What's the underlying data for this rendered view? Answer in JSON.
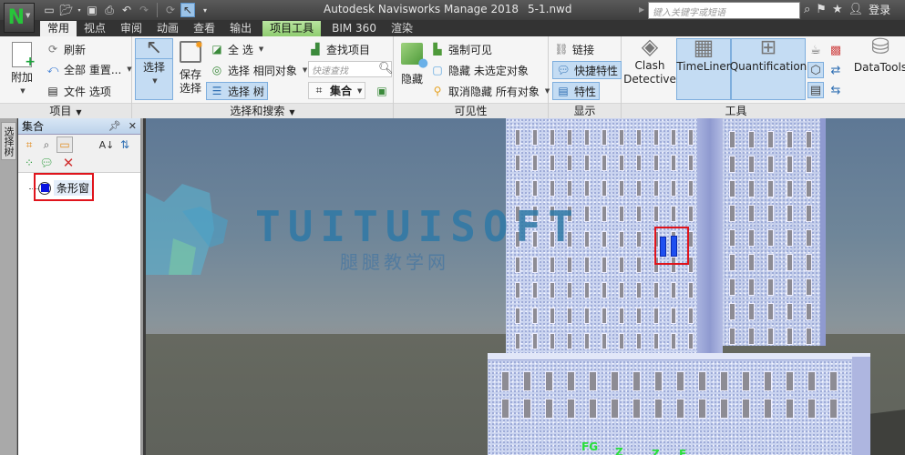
{
  "app": {
    "title": "Autodesk Navisworks Manage 2018",
    "filename": "5-1.nwd",
    "logo_letter": "N"
  },
  "quick_access": {
    "icons": [
      "new-file-icon",
      "open-folder-icon",
      "save-icon",
      "print-icon",
      "undo-icon",
      "redo-icon",
      "refresh-icon",
      "select-cursor-icon",
      "customize-dropdown-icon"
    ]
  },
  "search": {
    "placeholder": "键入关键字或短语"
  },
  "top_right": {
    "login_label": "登录"
  },
  "tabs": [
    {
      "label": "常用",
      "active": true
    },
    {
      "label": "视点"
    },
    {
      "label": "审阅"
    },
    {
      "label": "动画"
    },
    {
      "label": "查看"
    },
    {
      "label": "输出"
    },
    {
      "label": "项目工具",
      "contextual": true
    },
    {
      "label": "BIM 360"
    },
    {
      "label": "渲染"
    }
  ],
  "ribbon": {
    "project": {
      "label": "项目",
      "append": "附加",
      "refresh": "刷新",
      "reset_all": "全部 重置...",
      "file_options": "文件 选项"
    },
    "select_search": {
      "label": "选择和搜索",
      "select": "选择",
      "save_selection_1": "保存",
      "save_selection_2": "选择",
      "select_all": "全 选",
      "select_same": "选择 相同对象",
      "selection_tree": "选择 树",
      "find_items": "查找项目",
      "quick_find_placeholder": "快速查找",
      "sets": "集合"
    },
    "visibility": {
      "label": "可见性",
      "hide": "隐藏",
      "require": "强制可见",
      "hide_unselected": "隐藏 未选定对象",
      "unhide_all": "取消隐藏 所有对象"
    },
    "display": {
      "label": "显示",
      "links": "链接",
      "quick_properties": "快捷特性",
      "properties": "特性"
    },
    "tools": {
      "label": "工具",
      "clash_detective_1": "Clash",
      "clash_detective_2": "Detective",
      "timeliner": "TimeLiner",
      "quantification": "Quantification",
      "datatools": "DataTools"
    }
  },
  "side_tab": {
    "label": "选择树"
  },
  "sets_panel": {
    "title": "集合",
    "items": [
      {
        "label": "条形窗",
        "color": "#0a14e0"
      }
    ]
  },
  "viewport": {
    "watermark_en": "TUITUISOFT",
    "watermark_cn": "腿腿教学网",
    "grid_labels": [
      "FG",
      "Z",
      "Z",
      "E"
    ]
  },
  "colors": {
    "highlight_red": "#e0141c",
    "selected_blue": "#0a14e0",
    "contextual_tab_green": "#8fcc70"
  }
}
